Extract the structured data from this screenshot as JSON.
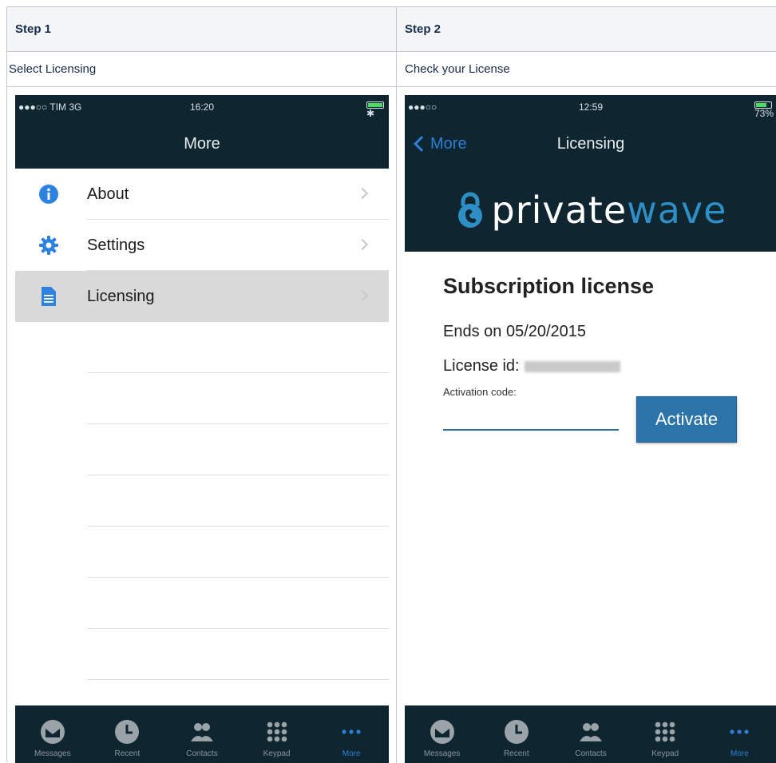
{
  "steps": [
    {
      "header": "Step 1",
      "instruction": "Select Licensing"
    },
    {
      "header": "Step 2",
      "instruction": "Check your License"
    }
  ],
  "phone1": {
    "status": {
      "carrier": "●●●○○ TIM  3G",
      "time": "16:20",
      "battery": "✱ 100%"
    },
    "title": "More",
    "menu": [
      {
        "label": "About",
        "icon": "info-icon"
      },
      {
        "label": "Settings",
        "icon": "gear-icon"
      },
      {
        "label": "Licensing",
        "icon": "document-icon",
        "selected": true
      }
    ]
  },
  "phone2": {
    "status": {
      "carrier": "●●●○○",
      "time": "12:59",
      "battery": "73%"
    },
    "back_label": "More",
    "title": "Licensing",
    "logo": {
      "part1": "private",
      "part2": "wave"
    },
    "license_title": "Subscription license",
    "ends_on": "Ends on 05/20/2015",
    "license_id_label": "License id:",
    "activation_label": "Activation code:",
    "activation_value": "",
    "activate_label": "Activate"
  },
  "tabs": [
    {
      "label": "Messages",
      "icon": "envelope-icon"
    },
    {
      "label": "Recent",
      "icon": "clock-icon"
    },
    {
      "label": "Contacts",
      "icon": "contacts-icon"
    },
    {
      "label": "Keypad",
      "icon": "keypad-icon"
    },
    {
      "label": "More",
      "icon": "more-icon",
      "active": true
    }
  ],
  "colors": {
    "dark_bar": "#0f2630",
    "accent": "#2d7fd6",
    "button": "#2a74a9",
    "logo_blue": "#2d8fc5"
  }
}
